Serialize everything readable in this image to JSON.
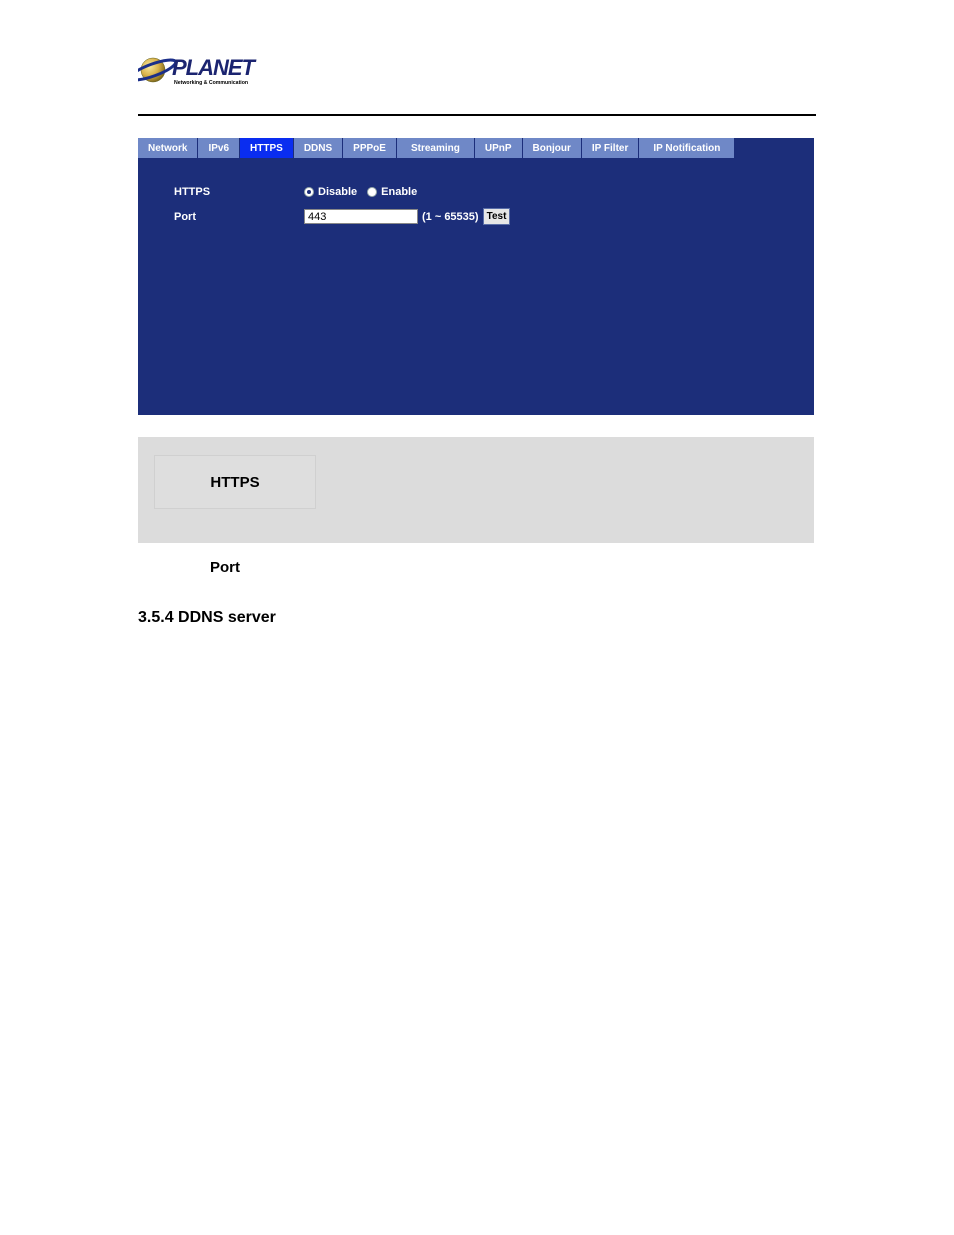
{
  "logo": {
    "brand": "PLANET",
    "tagline": "Networking & Communication"
  },
  "tabs": [
    {
      "label": "Network",
      "active": false
    },
    {
      "label": "IPv6",
      "active": false
    },
    {
      "label": "HTTPS",
      "active": true
    },
    {
      "label": "DDNS",
      "active": false
    },
    {
      "label": "PPPoE",
      "active": false
    },
    {
      "label": "Streaming",
      "active": false
    },
    {
      "label": "UPnP",
      "active": false
    },
    {
      "label": "Bonjour",
      "active": false
    },
    {
      "label": "IP Filter",
      "active": false
    },
    {
      "label": "IP Notification",
      "active": false
    }
  ],
  "form": {
    "https_label": "HTTPS",
    "port_label": "Port",
    "radio_disable": "Disable",
    "radio_enable": "Enable",
    "radio_selected": "disable",
    "port_value": "443",
    "port_range": "(1 ~ 65535)",
    "test_button": "Test"
  },
  "desc": {
    "https_heading": "HTTPS",
    "port_heading": "Port"
  },
  "section_heading": "3.5.4 DDNS server"
}
